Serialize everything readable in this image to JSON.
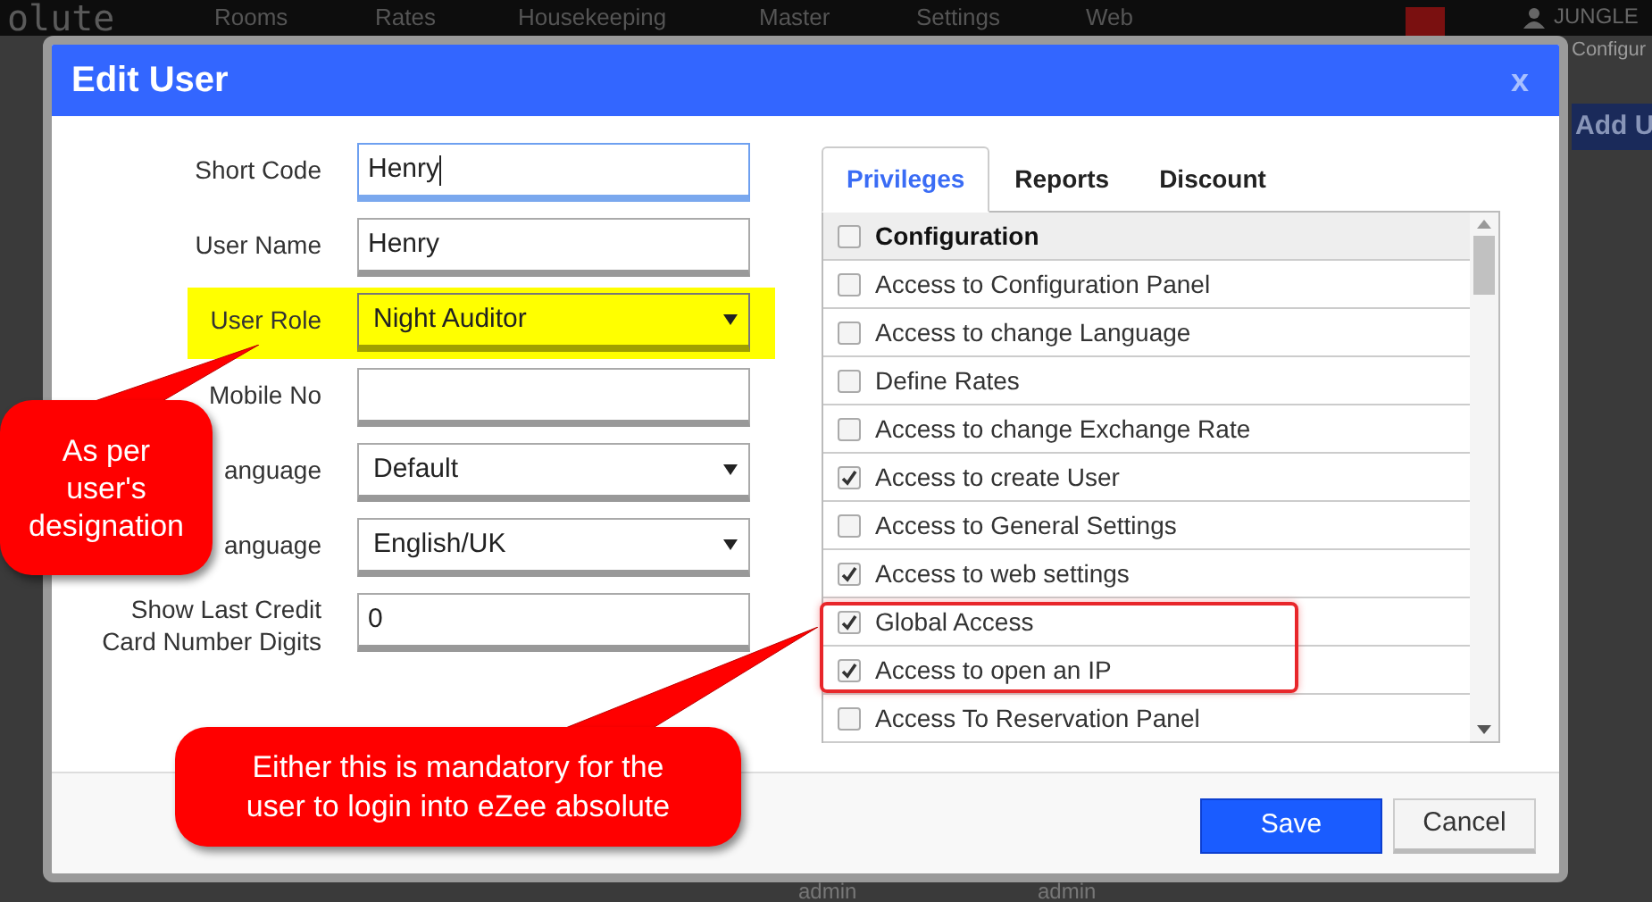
{
  "app_bar": {
    "logo": "olute",
    "nav": [
      "Rooms",
      "Rates",
      "Housekeeping",
      "Master",
      "Settings",
      "Web"
    ],
    "user": "JUNGLE",
    "user_sub": "Configur"
  },
  "background": {
    "button": "Add U",
    "cells": [
      "admin",
      "admin"
    ]
  },
  "dialog": {
    "title": "Edit User",
    "close": "x",
    "fields": [
      {
        "label": "Short Code",
        "kind": "text",
        "value": "Henry",
        "focused": true,
        "highlighted": false
      },
      {
        "label": "User Name",
        "kind": "text",
        "value": "Henry",
        "focused": false,
        "highlighted": false
      },
      {
        "label": "User Role",
        "kind": "select",
        "value": "Night Auditor",
        "focused": false,
        "highlighted": true
      },
      {
        "label": "Mobile No",
        "kind": "text",
        "focused": false,
        "highlighted": false
      },
      {
        "label": "anguage",
        "kind": "select",
        "value": "Default",
        "focused": false,
        "highlighted": false
      },
      {
        "label": "anguage",
        "kind": "select",
        "value": "English/UK",
        "focused": false,
        "highlighted": false
      },
      {
        "label": "Show Last Credit Card Number Digits",
        "kind": "text",
        "value": "0",
        "focused": false,
        "highlighted": false
      }
    ],
    "tabs": [
      {
        "label": "Privileges",
        "selected": true
      },
      {
        "label": "Reports",
        "selected": false
      },
      {
        "label": "Discount",
        "selected": false
      }
    ],
    "privileges": [
      {
        "label": "Configuration",
        "kind": "group",
        "checked": false
      },
      {
        "label": "Access to Configuration Panel",
        "kind": "item",
        "checked": false
      },
      {
        "label": "Access to change Language",
        "kind": "item",
        "checked": false
      },
      {
        "label": "Define Rates",
        "kind": "item",
        "checked": false
      },
      {
        "label": "Access to change Exchange Rate",
        "kind": "item",
        "checked": false
      },
      {
        "label": "Access to create User",
        "kind": "item",
        "checked": true
      },
      {
        "label": "Access to General Settings",
        "kind": "item",
        "checked": false
      },
      {
        "label": "Access to web settings",
        "kind": "item",
        "checked": true
      },
      {
        "label": "Global Access",
        "kind": "item",
        "checked": true
      },
      {
        "label": "Access to open an IP",
        "kind": "item",
        "checked": true
      },
      {
        "label": "Access To Reservation Panel",
        "kind": "item",
        "checked": false
      }
    ],
    "buttons": [
      {
        "label": "Save",
        "kind": "primary"
      },
      {
        "label": "Cancel",
        "kind": "secondary"
      }
    ]
  },
  "annotations": [
    {
      "kind": "callout",
      "text": "As per user's designation"
    },
    {
      "kind": "callout",
      "text": "Either this is mandatory for the user to login into eZee absolute"
    },
    {
      "kind": "frame"
    }
  ]
}
